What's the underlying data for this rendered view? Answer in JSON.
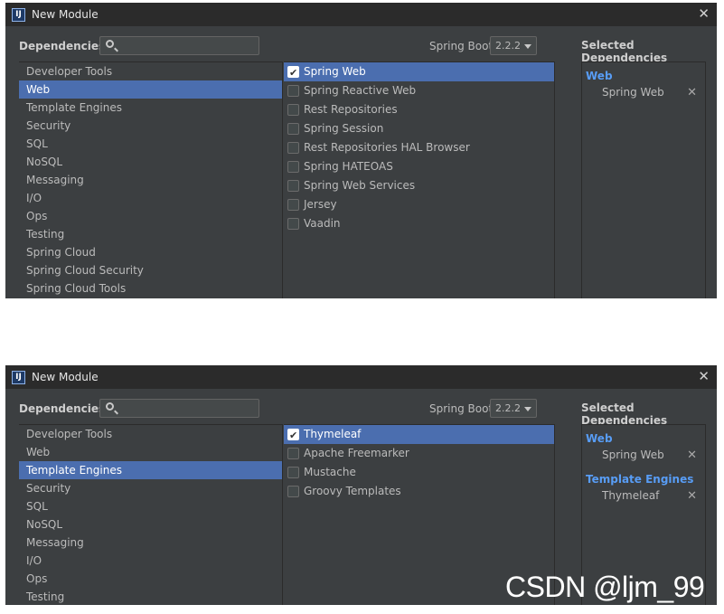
{
  "windows": [
    {
      "title": "New Module",
      "app_icon": "IJ",
      "dependencies_label": "Dependencies",
      "search": {
        "value": "",
        "placeholder": ""
      },
      "spring_boot_label": "Spring Boot",
      "spring_boot_version": "2.2.2",
      "selected_header": "Selected Dependencies",
      "categories": [
        {
          "label": "Developer Tools",
          "selected": false
        },
        {
          "label": "Web",
          "selected": true
        },
        {
          "label": "Template Engines",
          "selected": false
        },
        {
          "label": "Security",
          "selected": false
        },
        {
          "label": "SQL",
          "selected": false
        },
        {
          "label": "NoSQL",
          "selected": false
        },
        {
          "label": "Messaging",
          "selected": false
        },
        {
          "label": "I/O",
          "selected": false
        },
        {
          "label": "Ops",
          "selected": false
        },
        {
          "label": "Testing",
          "selected": false
        },
        {
          "label": "Spring Cloud",
          "selected": false
        },
        {
          "label": "Spring Cloud Security",
          "selected": false
        },
        {
          "label": "Spring Cloud Tools",
          "selected": false
        }
      ],
      "dependencies": [
        {
          "label": "Spring Web",
          "checked": true,
          "highlighted": true
        },
        {
          "label": "Spring Reactive Web",
          "checked": false,
          "highlighted": false
        },
        {
          "label": "Rest Repositories",
          "checked": false,
          "highlighted": false
        },
        {
          "label": "Spring Session",
          "checked": false,
          "highlighted": false
        },
        {
          "label": "Rest Repositories HAL Browser",
          "checked": false,
          "highlighted": false
        },
        {
          "label": "Spring HATEOAS",
          "checked": false,
          "highlighted": false
        },
        {
          "label": "Spring Web Services",
          "checked": false,
          "highlighted": false
        },
        {
          "label": "Jersey",
          "checked": false,
          "highlighted": false
        },
        {
          "label": "Vaadin",
          "checked": false,
          "highlighted": false
        }
      ],
      "selected_groups": [
        {
          "group": "Web",
          "items": [
            "Spring Web"
          ]
        }
      ]
    },
    {
      "title": "New Module",
      "app_icon": "IJ",
      "dependencies_label": "Dependencies",
      "search": {
        "value": "",
        "placeholder": ""
      },
      "spring_boot_label": "Spring Boot",
      "spring_boot_version": "2.2.2",
      "selected_header": "Selected Dependencies",
      "categories": [
        {
          "label": "Developer Tools",
          "selected": false
        },
        {
          "label": "Web",
          "selected": false
        },
        {
          "label": "Template Engines",
          "selected": true
        },
        {
          "label": "Security",
          "selected": false
        },
        {
          "label": "SQL",
          "selected": false
        },
        {
          "label": "NoSQL",
          "selected": false
        },
        {
          "label": "Messaging",
          "selected": false
        },
        {
          "label": "I/O",
          "selected": false
        },
        {
          "label": "Ops",
          "selected": false
        },
        {
          "label": "Testing",
          "selected": false
        }
      ],
      "dependencies": [
        {
          "label": "Thymeleaf",
          "checked": true,
          "highlighted": true
        },
        {
          "label": "Apache Freemarker",
          "checked": false,
          "highlighted": false
        },
        {
          "label": "Mustache",
          "checked": false,
          "highlighted": false
        },
        {
          "label": "Groovy Templates",
          "checked": false,
          "highlighted": false
        }
      ],
      "selected_groups": [
        {
          "group": "Web",
          "items": [
            "Spring Web"
          ]
        },
        {
          "group": "Template Engines",
          "items": [
            "Thymeleaf"
          ]
        }
      ]
    }
  ],
  "remove_glyph": "✕",
  "close_glyph": "✕",
  "watermark": "CSDN @ljm_99",
  "colors": {
    "window_bg": "#3c3f41",
    "titlebar_bg": "#2b2b2b",
    "selection": "#4b6eaf",
    "group_label": "#589df6",
    "text": "#bbbbbb"
  }
}
